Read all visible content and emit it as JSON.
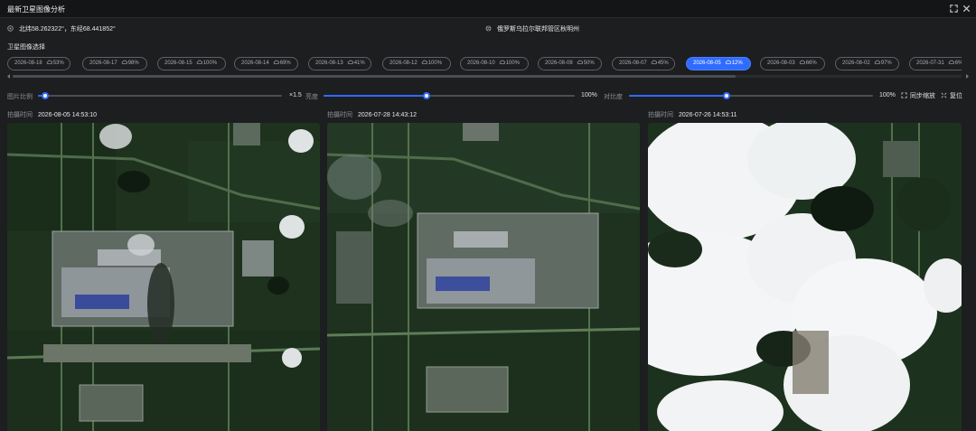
{
  "window": {
    "title": "最新卫星图像分析"
  },
  "info": {
    "coordinates": "北纬58.262322°，东经68.441852°",
    "region": "俄罗斯乌拉尔联邦管区秋明州"
  },
  "section_title": "卫星图像选择",
  "dates": [
    {
      "date": "2026-08-18",
      "cloud": "53%"
    },
    {
      "date": "2026-08-17",
      "cloud": "98%"
    },
    {
      "date": "2026-08-15",
      "cloud": "100%"
    },
    {
      "date": "2026-08-14",
      "cloud": "69%"
    },
    {
      "date": "2026-08-13",
      "cloud": "41%"
    },
    {
      "date": "2026-08-12",
      "cloud": "100%"
    },
    {
      "date": "2026-08-10",
      "cloud": "100%"
    },
    {
      "date": "2026-08-08",
      "cloud": "50%"
    },
    {
      "date": "2026-08-07",
      "cloud": "45%"
    },
    {
      "date": "2026-08-05",
      "cloud": "12%"
    },
    {
      "date": "2026-08-03",
      "cloud": "66%"
    },
    {
      "date": "2026-08-02",
      "cloud": "97%"
    },
    {
      "date": "2026-07-31",
      "cloud": "6%"
    }
  ],
  "selected_date_index": 9,
  "controls": {
    "scale": {
      "label": "图片比例",
      "value": "×1.5",
      "level": 0.03
    },
    "brightness": {
      "label": "亮度",
      "value": "100%",
      "level": 0.41
    },
    "contrast": {
      "label": "对比度",
      "value": "100%",
      "level": 0.4
    },
    "sync_zoom": "同步缩放",
    "reset": "复位"
  },
  "panes": [
    {
      "label": "拍摄时间",
      "time": "2026-08-05 14:53:10"
    },
    {
      "label": "拍摄时间",
      "time": "2026-07-28 14:43:12"
    },
    {
      "label": "拍摄时间",
      "time": "2026-07-26 14:53:11"
    }
  ],
  "colors": {
    "accent": "#2f6bff",
    "background": "#1d1e20",
    "titlebar": "#141517"
  },
  "icons": {
    "expand": "expand-icon",
    "close": "close-icon",
    "location": "location-pin-icon",
    "cloud": "cloud-icon",
    "sync": "sync-zoom-icon",
    "reset": "reset-icon"
  }
}
